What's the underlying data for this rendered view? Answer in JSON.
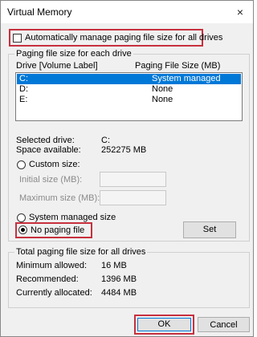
{
  "window": {
    "title": "Virtual Memory",
    "close_glyph": "×"
  },
  "auto_manage": {
    "label": "Automatically manage paging file size for all drives",
    "checked": false
  },
  "drive_group": {
    "legend": "Paging file size for each drive",
    "col_drive": "Drive  [Volume Label]",
    "col_size": "Paging File Size (MB)",
    "rows": [
      {
        "drive": "C:",
        "size": "System managed",
        "selected": true
      },
      {
        "drive": "D:",
        "size": "None",
        "selected": false
      },
      {
        "drive": "E:",
        "size": "None",
        "selected": false
      }
    ],
    "selected_drive_label": "Selected drive:",
    "selected_drive_value": "C:",
    "space_available_label": "Space available:",
    "space_available_value": "252275 MB",
    "custom_size_label": "Custom size:",
    "initial_size_label": "Initial size (MB):",
    "maximum_size_label": "Maximum size (MB):",
    "system_managed_label": "System managed size",
    "no_paging_label": "No paging file",
    "selected_option": "no_paging",
    "set_button": "Set"
  },
  "total_group": {
    "legend": "Total paging file size for all drives",
    "minimum_label": "Minimum allowed:",
    "minimum_value": "16 MB",
    "recommended_label": "Recommended:",
    "recommended_value": "1396 MB",
    "allocated_label": "Currently allocated:",
    "allocated_value": "4484 MB"
  },
  "footer": {
    "ok_button": "OK",
    "cancel_button": "Cancel"
  },
  "colors": {
    "highlight": "#c7303e",
    "selection": "#0078d7"
  }
}
